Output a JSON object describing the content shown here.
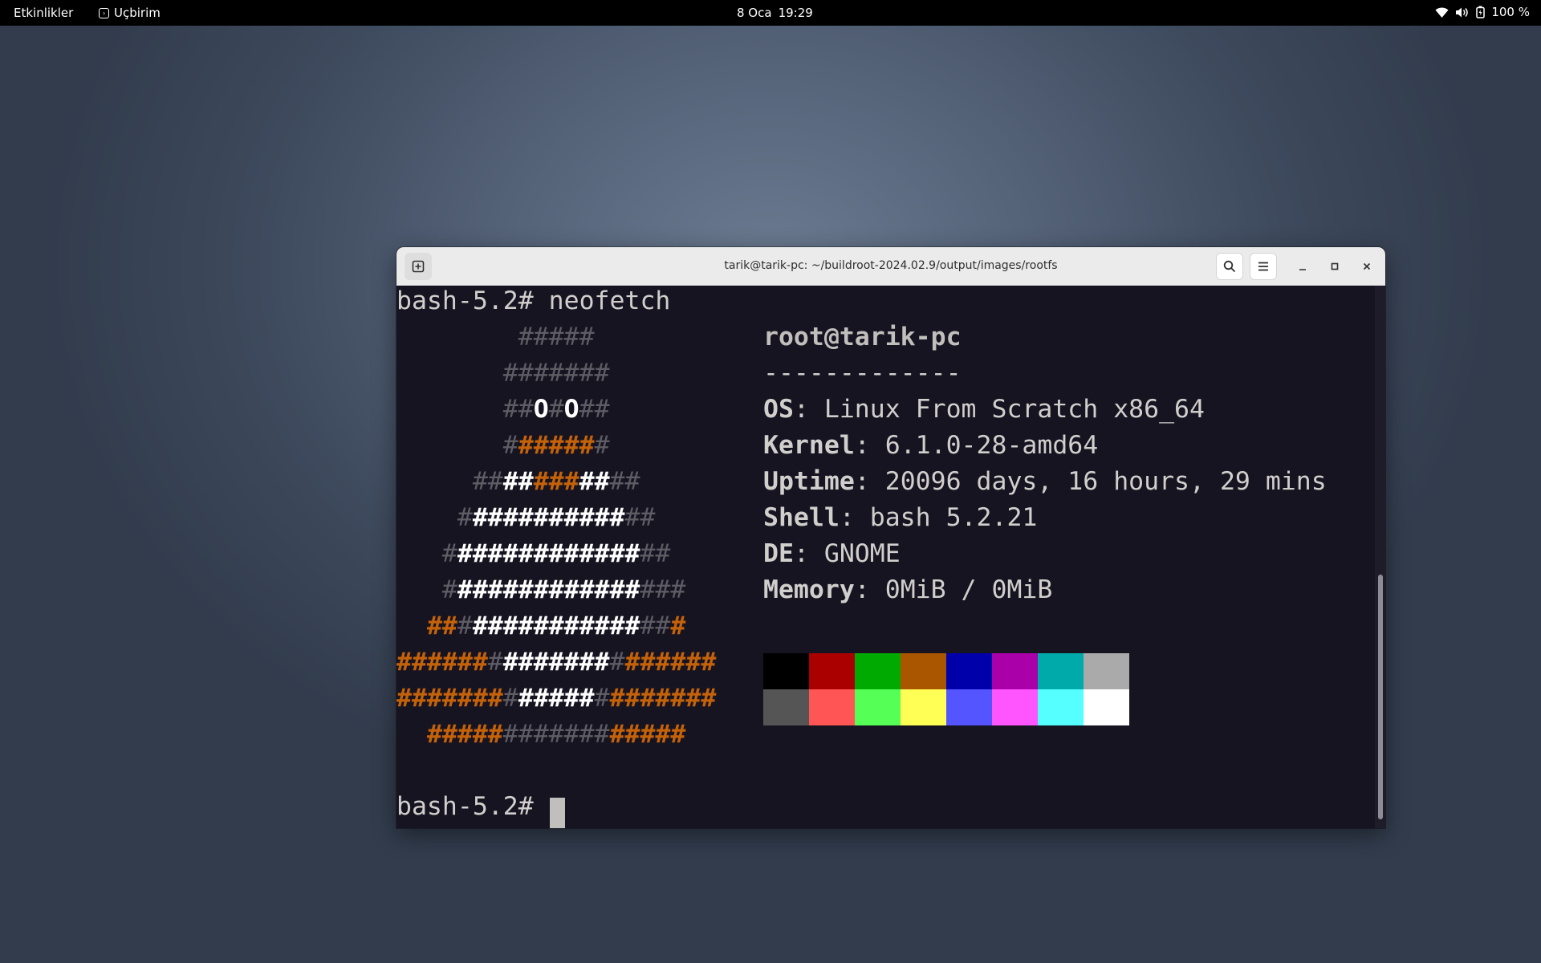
{
  "topbar": {
    "activities": "Etkinlikler",
    "app_name": "Uçbirim",
    "date": "8 Oca",
    "time": "19:29",
    "battery": "100 %"
  },
  "window": {
    "title": "tarik@tarik-pc: ~/buildroot-2024.02.9/output/images/rootfs"
  },
  "terminal": {
    "prompt": "bash-5.2#",
    "command": "neofetch",
    "userhost": "root@tarik-pc",
    "separator": "-------------",
    "info": [
      {
        "label": "OS",
        "value": ": Linux From Scratch x86_64"
      },
      {
        "label": "Kernel",
        "value": ": 6.1.0-28-amd64"
      },
      {
        "label": "Uptime",
        "value": ": 20096 days, 16 hours, 29 mins"
      },
      {
        "label": "Shell",
        "value": ": bash 5.2.21"
      },
      {
        "label": "DE",
        "value": ": GNOME"
      },
      {
        "label": "Memory",
        "value": ": 0MiB / 0MiB"
      }
    ],
    "palette_top": [
      "#000000",
      "#aa0000",
      "#00aa00",
      "#aa5500",
      "#0000aa",
      "#aa00aa",
      "#00aaaa",
      "#aaaaaa"
    ],
    "palette_bottom": [
      "#555555",
      "#ff5555",
      "#55ff55",
      "#ffff55",
      "#5555ff",
      "#ff55ff",
      "#55ffff",
      "#ffffff"
    ],
    "ascii_art": [
      [
        [
          "        ",
          ""
        ],
        [
          "#####",
          "g1"
        ]
      ],
      [
        [
          "       ",
          ""
        ],
        [
          "#######",
          "g1"
        ]
      ],
      [
        [
          "       ",
          ""
        ],
        [
          "##",
          "g1"
        ],
        [
          "O",
          "w1"
        ],
        [
          "#",
          "g1"
        ],
        [
          "O",
          "w1"
        ],
        [
          "##",
          "g1"
        ]
      ],
      [
        [
          "       ",
          ""
        ],
        [
          "#",
          "g1"
        ],
        [
          "#####",
          "o1"
        ],
        [
          "#",
          "g1"
        ]
      ],
      [
        [
          "     ",
          ""
        ],
        [
          "##",
          "g1"
        ],
        [
          "##",
          "w1"
        ],
        [
          "###",
          "o1"
        ],
        [
          "##",
          "w1"
        ],
        [
          "##",
          "g1"
        ]
      ],
      [
        [
          "    ",
          ""
        ],
        [
          "#",
          "g1"
        ],
        [
          "##########",
          "w1"
        ],
        [
          "##",
          "g1"
        ]
      ],
      [
        [
          "   ",
          ""
        ],
        [
          "#",
          "g1"
        ],
        [
          "############",
          "w1"
        ],
        [
          "##",
          "g1"
        ]
      ],
      [
        [
          "   ",
          ""
        ],
        [
          "#",
          "g1"
        ],
        [
          "############",
          "w1"
        ],
        [
          "###",
          "g1"
        ]
      ],
      [
        [
          "  ",
          ""
        ],
        [
          "##",
          "o1"
        ],
        [
          "#",
          "g1"
        ],
        [
          "###########",
          "w1"
        ],
        [
          "##",
          "g1"
        ],
        [
          "#",
          "o1"
        ]
      ],
      [
        [
          "######",
          "o1"
        ],
        [
          "#",
          "g1"
        ],
        [
          "#######",
          "w1"
        ],
        [
          "#",
          "g1"
        ],
        [
          "######",
          "o1"
        ]
      ],
      [
        [
          "#######",
          "o1"
        ],
        [
          "#",
          "g1"
        ],
        [
          "#####",
          "w1"
        ],
        [
          "#",
          "g1"
        ],
        [
          "#######",
          "o1"
        ]
      ],
      [
        [
          "  ",
          ""
        ],
        [
          "#####",
          "o1"
        ],
        [
          "#######",
          "g1"
        ],
        [
          "#####",
          "o1"
        ]
      ]
    ]
  }
}
